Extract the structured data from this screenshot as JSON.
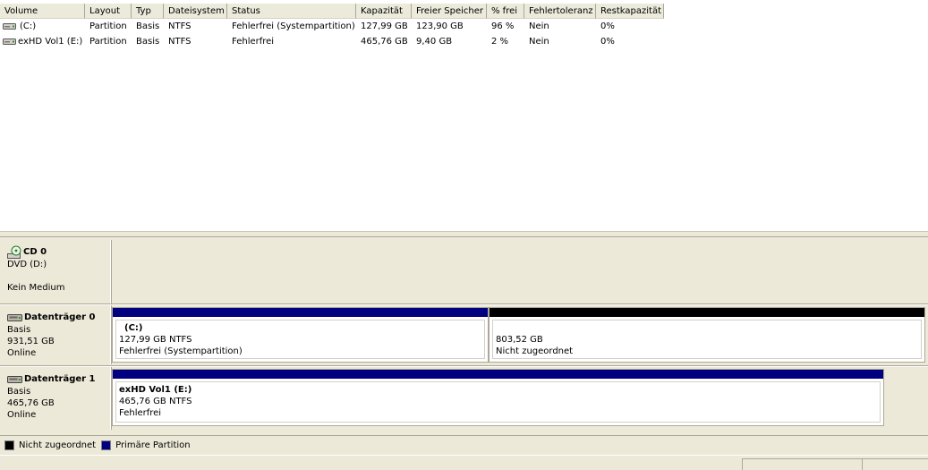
{
  "colors": {
    "primary_partition": "#000080",
    "unallocated": "#000000"
  },
  "list": {
    "columns": [
      "Volume",
      "Layout",
      "Typ",
      "Dateisystem",
      "Status",
      "Kapazität",
      "Freier Speicher",
      "% frei",
      "Fehlertoleranz",
      "Restkapazität"
    ],
    "rows": [
      {
        "icon": "drive-icon",
        "volume": "(C:)",
        "layout": "Partition",
        "typ": "Basis",
        "dateisystem": "NTFS",
        "status": "Fehlerfrei (Systempartition)",
        "kapazitaet": "127,99 GB",
        "freier_speicher": "123,90 GB",
        "prozent_frei": "96 %",
        "fehlertoleranz": "Nein",
        "restkapazitaet": "0%"
      },
      {
        "icon": "drive-icon",
        "volume": "exHD Vol1 (E:)",
        "layout": "Partition",
        "typ": "Basis",
        "dateisystem": "NTFS",
        "status": "Fehlerfrei",
        "kapazitaet": "465,76 GB",
        "freier_speicher": "9,40 GB",
        "prozent_frei": "2 %",
        "fehlertoleranz": "Nein",
        "restkapazitaet": "0%"
      }
    ]
  },
  "disks": {
    "cd0": {
      "icon": "cd-drive-icon",
      "title": "CD 0",
      "type": "DVD (D:)",
      "medium": "Kein Medium"
    },
    "disk0": {
      "icon": "hard-disk-icon",
      "title": "Datenträger 0",
      "type": "Basis",
      "size": "931,51 GB",
      "state": "Online",
      "partitions": [
        {
          "name": "(C:)",
          "size": "127,99 GB NTFS",
          "status": "Fehlerfrei (Systempartition)",
          "kind": "primary"
        },
        {
          "name": "",
          "size": "803,52 GB",
          "status": "Nicht zugeordnet",
          "kind": "unallocated"
        }
      ]
    },
    "disk1": {
      "icon": "hard-disk-icon",
      "title": "Datenträger 1",
      "type": "Basis",
      "size": "465,76 GB",
      "state": "Online",
      "partitions": [
        {
          "name": "exHD Vol1  (E:)",
          "size": "465,76 GB NTFS",
          "status": "Fehlerfrei",
          "kind": "primary"
        }
      ]
    }
  },
  "legend": {
    "unallocated_label": "Nicht zugeordnet",
    "primary_label": "Primäre Partition"
  }
}
